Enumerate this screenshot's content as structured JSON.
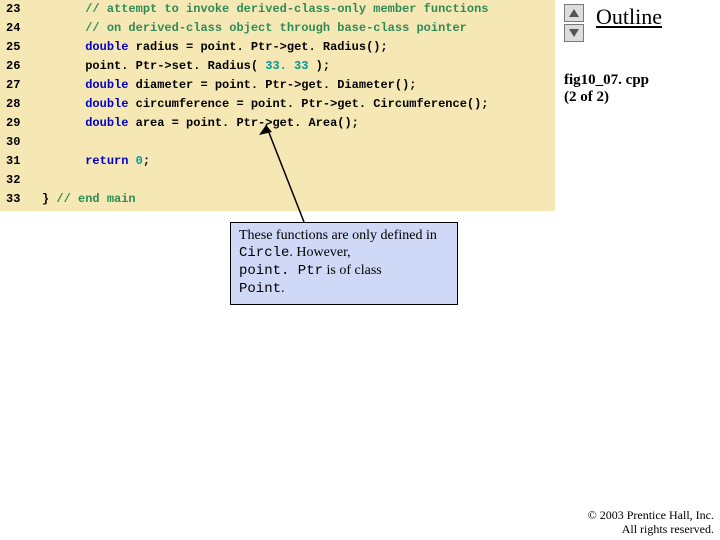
{
  "side": {
    "outline": "Outline",
    "file": "fig10_07. cpp",
    "page": "(2 of 2)"
  },
  "callout": {
    "p1a": "These functions are only defined in ",
    "p1b": "Circle",
    "p1c": ". However, ",
    "p2a": "point. Ptr",
    "p2b": " is of class ",
    "p3a": "Point",
    "p3b": "."
  },
  "copyright": {
    "l1": "© 2003 Prentice Hall, Inc.",
    "l2": "All rights reserved."
  },
  "code": {
    "lines": [
      {
        "num": "23",
        "segs": [
          [
            "pad",
            "      "
          ],
          [
            "c",
            "// attempt to invoke derived-class-only member functions"
          ]
        ]
      },
      {
        "num": "24",
        "segs": [
          [
            "pad",
            "      "
          ],
          [
            "c",
            "// on derived-class object through base-class pointer"
          ]
        ]
      },
      {
        "num": "25",
        "segs": [
          [
            "pad",
            "      "
          ],
          [
            "k",
            "double"
          ],
          [
            "t",
            " radius = point. Ptr->get. Radius();"
          ]
        ]
      },
      {
        "num": "26",
        "segs": [
          [
            "pad",
            "      "
          ],
          [
            "t",
            "point. Ptr->set. Radius( "
          ],
          [
            "n",
            "33. 33"
          ],
          [
            "t",
            " );"
          ]
        ]
      },
      {
        "num": "27",
        "segs": [
          [
            "pad",
            "      "
          ],
          [
            "k",
            "double"
          ],
          [
            "t",
            " diameter = point. Ptr->get. Diameter();"
          ]
        ]
      },
      {
        "num": "28",
        "segs": [
          [
            "pad",
            "      "
          ],
          [
            "k",
            "double"
          ],
          [
            "t",
            " circumference = point. Ptr->get. Circumference();"
          ]
        ]
      },
      {
        "num": "29",
        "segs": [
          [
            "pad",
            "      "
          ],
          [
            "k",
            "double"
          ],
          [
            "t",
            " area = point. Ptr->get. Area();"
          ]
        ]
      },
      {
        "num": "30",
        "segs": [
          [
            "t",
            ""
          ]
        ]
      },
      {
        "num": "31",
        "segs": [
          [
            "pad",
            "      "
          ],
          [
            "k",
            "return"
          ],
          [
            "t",
            " "
          ],
          [
            "n",
            "0"
          ],
          [
            "t",
            ";"
          ]
        ]
      },
      {
        "num": "32",
        "segs": [
          [
            "t",
            ""
          ]
        ]
      },
      {
        "num": "33",
        "segs": [
          [
            "t",
            "} "
          ],
          [
            "c",
            "// end main"
          ]
        ]
      }
    ]
  }
}
